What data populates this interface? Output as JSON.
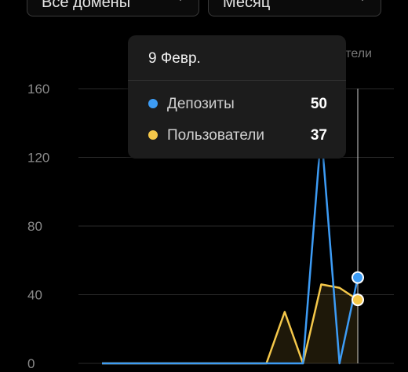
{
  "filters": {
    "domains_label": "Все домены",
    "period_label": "Месяц"
  },
  "legend_fragment": "тели",
  "tooltip": {
    "date": "9 Февр.",
    "rows": [
      {
        "name": "Депозиты",
        "value": "50",
        "color": "#3d9cf5"
      },
      {
        "name": "Пользователи",
        "value": "37",
        "color": "#f5c84a"
      }
    ]
  },
  "colors": {
    "background": "#000000",
    "deposits": "#3d9cf5",
    "users": "#f5c84a",
    "grid": "#2a2a2a"
  },
  "chart_data": {
    "type": "line",
    "ylim": [
      0,
      160
    ],
    "yticks": [
      0,
      40,
      80,
      120,
      160
    ],
    "hover_index": 14,
    "x": [
      1,
      2,
      3,
      4,
      5,
      6,
      7,
      8,
      9,
      10,
      11,
      12,
      13,
      14,
      15
    ],
    "series": [
      {
        "name": "Депозиты",
        "color": "#3d9cf5",
        "values": [
          0,
          0,
          0,
          0,
          0,
          0,
          0,
          0,
          0,
          0,
          0,
          0,
          135,
          0,
          50
        ]
      },
      {
        "name": "Пользователи",
        "color": "#f5c84a",
        "values": [
          0,
          0,
          0,
          0,
          0,
          0,
          0,
          0,
          0,
          0,
          30,
          0,
          46,
          44,
          37
        ]
      }
    ]
  }
}
